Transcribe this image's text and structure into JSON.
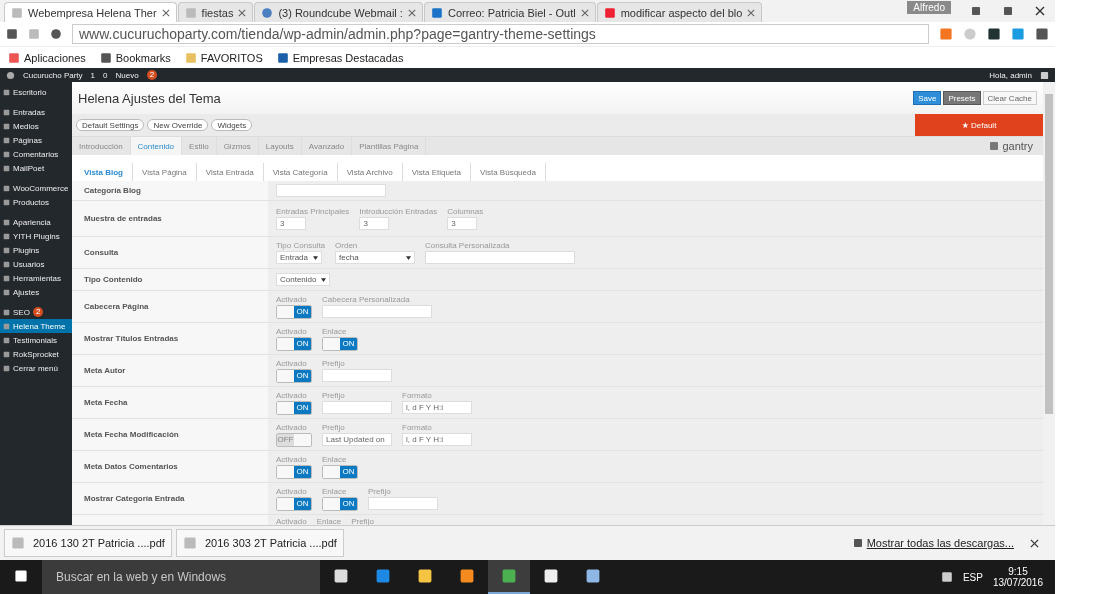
{
  "browser": {
    "tabs": [
      {
        "title": "Webempresa Helena Ther",
        "selected": true
      },
      {
        "title": "fiestas",
        "selected": false
      },
      {
        "title": "(3) Roundcube Webmail :",
        "selected": false
      },
      {
        "title": "Correo: Patricia Biel - Outl",
        "selected": false
      },
      {
        "title": "modificar aspecto del blo",
        "selected": false
      }
    ],
    "user": "Alfredo",
    "url": "www.cucuruchoparty.com/tienda/wp-admin/admin.php?page=gantry-theme-settings",
    "bookmarks": [
      "Aplicaciones",
      "Bookmarks",
      "FAVORITOS",
      "Empresas Destacadas"
    ]
  },
  "adminbar": {
    "site": "Cucurucho Party",
    "updates": "1",
    "comments": "0",
    "new": "Nuevo",
    "badge": "2",
    "greeting": "Hola, admin"
  },
  "sidebar": {
    "groups": [
      [
        {
          "label": "Escritorio",
          "selected": false
        }
      ],
      [
        {
          "label": "Entradas",
          "selected": false
        },
        {
          "label": "Medios",
          "selected": false
        },
        {
          "label": "Páginas",
          "selected": false
        },
        {
          "label": "Comentarios",
          "selected": false
        },
        {
          "label": "MailPoet",
          "selected": false
        }
      ],
      [
        {
          "label": "WooCommerce",
          "selected": false
        },
        {
          "label": "Productos",
          "selected": false
        }
      ],
      [
        {
          "label": "Apariencia",
          "selected": false
        },
        {
          "label": "YITH Plugins",
          "selected": false
        },
        {
          "label": "Plugins",
          "selected": false
        },
        {
          "label": "Usuarios",
          "selected": false
        },
        {
          "label": "Herramientas",
          "selected": false
        },
        {
          "label": "Ajustes",
          "selected": false
        }
      ],
      [
        {
          "label": "SEO",
          "selected": false,
          "badge": "2"
        },
        {
          "label": "Helena Theme",
          "selected": true
        },
        {
          "label": "Testimonials",
          "selected": false
        },
        {
          "label": "RokSprocket",
          "selected": false
        },
        {
          "label": "Cerrar menú",
          "selected": false
        }
      ]
    ]
  },
  "page": {
    "title": "Helena Ajustes del Tema",
    "save": "Save",
    "presets": "Presets",
    "clear_cache": "Clear Cache",
    "override_select": "Default Settings",
    "new_override": "New Override",
    "widgets": "Widgets",
    "default_badge": "★ Default",
    "logo": "gantry",
    "tabs": [
      {
        "label": "Introducción",
        "selected": false
      },
      {
        "label": "Contenido",
        "selected": true
      },
      {
        "label": "Estilo",
        "selected": false
      },
      {
        "label": "Gizmos",
        "selected": false
      },
      {
        "label": "Layouts",
        "selected": false
      },
      {
        "label": "Avanzado",
        "selected": false
      },
      {
        "label": "Plantillas Página",
        "selected": false
      }
    ],
    "subtabs": [
      {
        "label": "Vista Blog",
        "selected": true
      },
      {
        "label": "Vista Página",
        "selected": false
      },
      {
        "label": "Vista Entrada",
        "selected": false
      },
      {
        "label": "Vista Categoría",
        "selected": false
      },
      {
        "label": "Vista Archivo",
        "selected": false
      },
      {
        "label": "Vista Etiqueta",
        "selected": false
      },
      {
        "label": "Vista Búsqueda",
        "selected": false
      }
    ],
    "rows": [
      {
        "label": "Categoría Blog",
        "fields": [
          {
            "kind": "text"
          }
        ]
      },
      {
        "label": "Muestra de entradas",
        "fields": [
          {
            "kind": "text",
            "caption": "Entradas Principales",
            "value": "3"
          },
          {
            "kind": "text",
            "caption": "Introducción Entradas",
            "value": "3"
          },
          {
            "kind": "text",
            "caption": "Columnas",
            "value": "3"
          }
        ]
      },
      {
        "label": "Consulta",
        "fields": [
          {
            "kind": "select",
            "caption": "Tipo Consulta",
            "value": "Entrada"
          },
          {
            "kind": "select",
            "caption": "Orden",
            "value": "fecha"
          },
          {
            "kind": "text",
            "caption": "Consulta Personalizada"
          }
        ]
      },
      {
        "label": "Tipo Contenido",
        "fields": [
          {
            "kind": "select",
            "value": "Contenido"
          }
        ]
      },
      {
        "label": "Cabecera Página",
        "fields": [
          {
            "kind": "toggle",
            "caption": "Activado",
            "on": true,
            "text": "ON"
          },
          {
            "kind": "text",
            "caption": "Cabecera Personalizada"
          }
        ]
      },
      {
        "label": "Mostrar Títulos Entradas",
        "fields": [
          {
            "kind": "toggle",
            "caption": "Activado",
            "on": true,
            "text": "ON"
          },
          {
            "kind": "toggle",
            "caption": "Enlace",
            "on": true,
            "text": "ON"
          }
        ]
      },
      {
        "label": "Meta Autor",
        "fields": [
          {
            "kind": "toggle",
            "caption": "Activado",
            "on": true,
            "text": "ON"
          },
          {
            "kind": "text",
            "caption": "Prefijo"
          }
        ]
      },
      {
        "label": "Meta Fecha",
        "fields": [
          {
            "kind": "toggle",
            "caption": "Activado",
            "on": true,
            "text": "ON"
          },
          {
            "kind": "text",
            "caption": "Prefijo"
          },
          {
            "kind": "text",
            "caption": "Formato",
            "value": "l, d F Y H:i"
          }
        ]
      },
      {
        "label": "Meta Fecha Modificación",
        "fields": [
          {
            "kind": "toggle",
            "caption": "Activado",
            "on": false,
            "text": "OFF"
          },
          {
            "kind": "text",
            "caption": "Prefijo",
            "value": "Last Updated on"
          },
          {
            "kind": "text",
            "caption": "Formato",
            "value": "l, d F Y H:i"
          }
        ]
      },
      {
        "label": "Meta Datos Comentarios",
        "fields": [
          {
            "kind": "toggle",
            "caption": "Activado",
            "on": true,
            "text": "ON"
          },
          {
            "kind": "toggle",
            "caption": "Enlace",
            "on": true,
            "text": "ON"
          }
        ]
      },
      {
        "label": "Mostrar Categoría Entrada",
        "fields": [
          {
            "kind": "toggle",
            "caption": "Activado",
            "on": true,
            "text": "ON"
          },
          {
            "kind": "toggle",
            "caption": "Enlace",
            "on": true,
            "text": "ON"
          },
          {
            "kind": "text",
            "caption": "Prefijo"
          }
        ]
      },
      {
        "fields": [
          {
            "kind": "caption",
            "caption": "Activado"
          },
          {
            "kind": "caption",
            "caption": "Enlace"
          },
          {
            "kind": "caption",
            "caption": "Prefijo"
          }
        ]
      }
    ]
  },
  "downloads": {
    "items": [
      {
        "name": "2016 130 2T Patricia ....pdf"
      },
      {
        "name": "2016 303 2T Patricia ....pdf"
      }
    ],
    "show_all": "Mostrar todas las descargas..."
  },
  "taskbar": {
    "search_placeholder": "Buscar en la web y en Windows",
    "apps": [
      {
        "selected": false
      },
      {
        "selected": false
      },
      {
        "selected": false
      },
      {
        "selected": false
      },
      {
        "selected": true
      },
      {
        "selected": false
      },
      {
        "selected": false
      }
    ],
    "language": "ESP",
    "time": "9:15",
    "date": "13/07/2016"
  }
}
